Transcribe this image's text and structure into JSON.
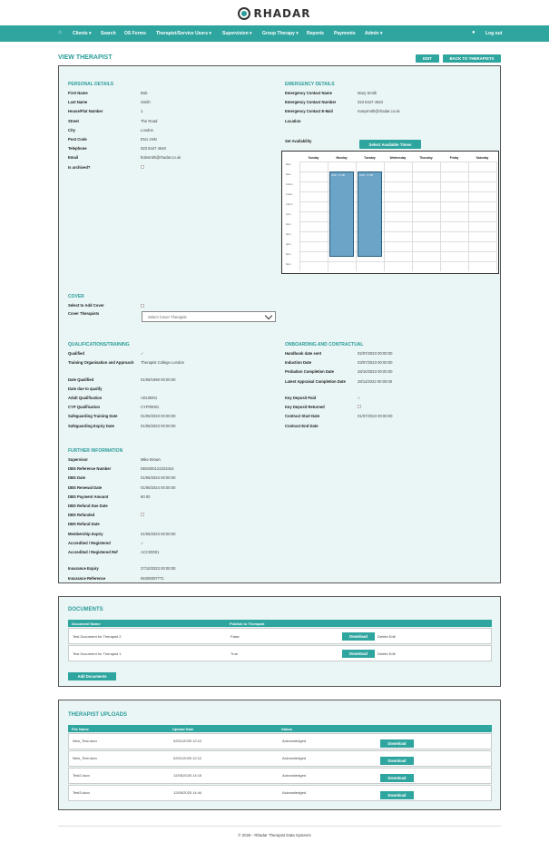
{
  "brand": {
    "name": "RHADAR",
    "accent": "#2fa59f"
  },
  "nav": {
    "home_icon": "home-icon",
    "items": [
      "Clients",
      "Search",
      "OS Forms",
      "Therapist/Service Users",
      "Supervision",
      "Group Therapy",
      "Reports",
      "Payments",
      "Admin"
    ],
    "user_icon": "user-icon",
    "logout": "Log out"
  },
  "page": {
    "title": "VIEW THERAPIST",
    "edit": "EDIT",
    "back": "BACK TO THERAPISTS"
  },
  "personal": {
    "title": "PERSONAL DETAILS",
    "rows": [
      [
        "First Name",
        "Bob"
      ],
      [
        "Last Name",
        "Smith"
      ],
      [
        "House/Flat Number",
        "1"
      ],
      [
        "Street",
        "The Road"
      ],
      [
        "City",
        "London"
      ],
      [
        "Post Code",
        "EN1 1NN"
      ],
      [
        "Telephone",
        "023 8447 4540"
      ],
      [
        "Email",
        "bobsmith@rhadar.co.uk"
      ],
      [
        "Is archived?",
        ""
      ]
    ]
  },
  "emergency": {
    "title": "EMERGENCY DETAILS",
    "rows": [
      [
        "Emergency Contact Name",
        "Mary Smith"
      ],
      [
        "Emergency Contact Number",
        "023 8447 4540"
      ],
      [
        "Emergency Contact E-Mail",
        "marysmith@rhadar.co.uk"
      ],
      [
        "Location",
        ""
      ]
    ],
    "set_availability": "Set Availability",
    "select_times": "Select Available Times"
  },
  "calendar": {
    "days": [
      "Sunday",
      "Monday",
      "Tuesday",
      "Wednesday",
      "Thursday",
      "Friday",
      "Saturday"
    ],
    "times": [
      "8am",
      "9am",
      "10am",
      "11am",
      "12pm",
      "1pm",
      "2pm",
      "3pm",
      "4pm",
      "5pm",
      "6pm"
    ],
    "block_monday": "9:00 - 17:30",
    "block_tuesday": "9:00 - 17:30"
  },
  "cover": {
    "title": "COVER",
    "select_label": "Select to Add Cover",
    "therapists_label": "Cover Therapists",
    "placeholder": "Select Cover Therapist"
  },
  "quals": {
    "title": "QUALIFICATIONS/TRAINING",
    "rows": [
      [
        "Qualified",
        "✓"
      ],
      [
        "Training Organisation and Approach",
        "Therapist College London"
      ],
      [
        "Date Qualified",
        "01/06/1990 00:00:00"
      ],
      [
        "Date due to qualify",
        ""
      ],
      [
        "Adult Qualification",
        "ADU0001"
      ],
      [
        "CYP Qualification",
        "CYP00001"
      ],
      [
        "Safeguarding Training Date",
        "01/06/2023 00:00:00"
      ],
      [
        "Safeguarding Expiry Date",
        "01/06/2023 00:00:00"
      ]
    ]
  },
  "onboarding": {
    "title": "ONBOARDING AND CONTRACTUAL",
    "rows": [
      [
        "Handbook date sent",
        "02/07/2023 00:00:00"
      ],
      [
        "Induction Date",
        "03/07/2023 00:00:00"
      ],
      [
        "Probation Completion Date",
        "28/10/2023 00:00:00"
      ],
      [
        "Latest Appraisal Completion Date",
        "28/11/2022 00:00:00"
      ],
      [
        "Key Deposit Paid",
        "✓"
      ],
      [
        "Key Deposit Returned",
        ""
      ],
      [
        "Contract Start Date",
        "01/07/2023 00:00:00"
      ],
      [
        "Contract End Date",
        ""
      ]
    ]
  },
  "further": {
    "title": "FURTHER INFORMATION",
    "rows": [
      [
        "Supervisor",
        "Mike Brown"
      ],
      [
        "DBS Reference Number",
        "DBS000122223424"
      ],
      [
        "DBS Date",
        "01/06/2023 00:00:00"
      ],
      [
        "DBS Renewal Date",
        "01/06/2024 00:00:00"
      ],
      [
        "DBS Payment Amount",
        "60.00"
      ],
      [
        "DBS Refund Due Date",
        ""
      ],
      [
        "DBS Refunded",
        ""
      ],
      [
        "DBS Refund Date",
        ""
      ],
      [
        "Membership Expiry",
        "01/06/2023 00:00:00"
      ],
      [
        "Accredited / Registered",
        "✓"
      ],
      [
        "Accredited / Registered Ref",
        "ACC00001"
      ],
      [
        "Insurance Expiry",
        "27/10/2023 00:00:00"
      ],
      [
        "Insurance Reference",
        "INS00007771"
      ]
    ]
  },
  "documents": {
    "title": "DOCUMENTS",
    "headers": [
      "Document Name",
      "Publish to Therapist"
    ],
    "rows": [
      {
        "name": "Test Document for Therapist 2",
        "publish": "False"
      },
      {
        "name": "Test Document for Therapist 1",
        "publish": "True"
      }
    ],
    "download": "Download",
    "delete_edit": "Delete Edit",
    "add": "Add Documents"
  },
  "uploads": {
    "title": "THERAPIST UPLOADS",
    "headers": [
      "File Name",
      "Upload Date",
      "Status"
    ],
    "rows": [
      {
        "file": "New_Test.docx",
        "date": "02/01/2025 12:12",
        "status": "Acknowledged"
      },
      {
        "file": "New_Test.docx",
        "date": "02/01/2025 12:12",
        "status": "Acknowledged"
      },
      {
        "file": "Test2.docx",
        "date": "12/05/2025 14:15",
        "status": "Acknowledged"
      },
      {
        "file": "Test3.docx",
        "date": "12/05/2025 14:44",
        "status": "Acknowledged"
      }
    ],
    "download": "Download"
  },
  "footer": "© 2026 - Rhadar Therapist Data Systems"
}
